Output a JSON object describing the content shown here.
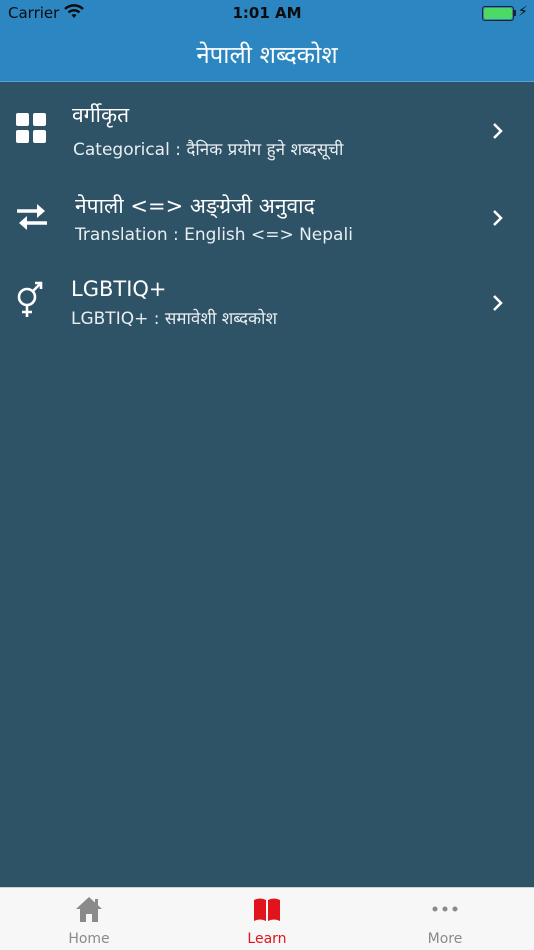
{
  "status_bar": {
    "carrier": "Carrier",
    "time": "1:01 AM",
    "battery_level": 1.0
  },
  "nav": {
    "title": "नेपाली शब्दकोश"
  },
  "list": {
    "items": [
      {
        "title": "वर्गीकृत",
        "subtitle": "Categorical : दैनिक प्रयोग हुने शब्दसूची",
        "icon": "grid-icon"
      },
      {
        "title": "नेपाली <=> अङ्ग्रेजी अनुवाद",
        "subtitle": "Translation : English <=> Nepali",
        "icon": "swap-arrows-icon"
      },
      {
        "title": "LGBTIQ+",
        "subtitle": "LGBTIQ+ : समावेशी शब्दकोश",
        "icon": "gender-symbol-icon"
      }
    ]
  },
  "tab_bar": {
    "tabs": [
      {
        "label": "Home",
        "icon": "home-icon"
      },
      {
        "label": "Learn",
        "icon": "book-icon",
        "active": true
      },
      {
        "label": "More",
        "icon": "more-dots-icon"
      }
    ]
  },
  "colors": {
    "nav_background": "#2b86c1",
    "content_background": "#2e5266",
    "active_tab": "#e0141c",
    "inactive_tab": "#8a8a8a",
    "battery": "#4cd964"
  }
}
